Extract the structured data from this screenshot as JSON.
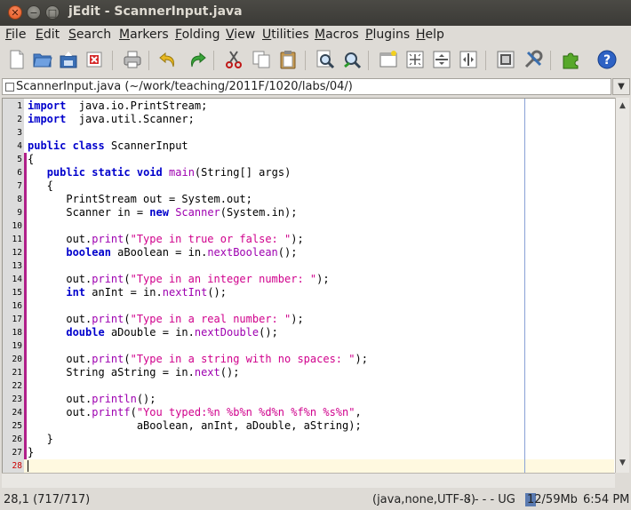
{
  "window": {
    "title": "jEdit - ScannerInput.java"
  },
  "menu": [
    {
      "mnemonic": "F",
      "rest": "ile"
    },
    {
      "mnemonic": "E",
      "rest": "dit"
    },
    {
      "mnemonic": "S",
      "rest": "earch"
    },
    {
      "mnemonic": "M",
      "rest": "arkers"
    },
    {
      "mnemonic": "F",
      "rest": "olding"
    },
    {
      "mnemonic": "V",
      "rest": "iew"
    },
    {
      "mnemonic": "U",
      "rest": "tilities"
    },
    {
      "mnemonic": "M",
      "rest": "acros"
    },
    {
      "mnemonic": "P",
      "rest": "lugins"
    },
    {
      "mnemonic": "H",
      "rest": "elp"
    }
  ],
  "toolbar": {
    "icons": [
      "new-file-icon",
      "open-file-icon",
      "reload-icon",
      "close-buffer-icon",
      "print-icon",
      "undo-icon",
      "redo-icon",
      "cut-icon",
      "copy-icon",
      "paste-icon",
      "find-icon",
      "find-next-icon",
      "new-view-icon",
      "split-horizontal-icon",
      "split-vertical-icon",
      "unsplit-icon",
      "buffer-options-icon",
      "global-options-icon",
      "plugin-manager-icon",
      "help-icon"
    ]
  },
  "buffer": {
    "label": "ScannerInput.java (~/work/teaching/2011F/1020/labs/04/)"
  },
  "editor": {
    "current_line": 28,
    "lines": [
      [
        [
          "kw",
          "import"
        ],
        [
          "",
          "  java.io.PrintStream;"
        ]
      ],
      [
        [
          "kw",
          "import"
        ],
        [
          "",
          "  java.util.Scanner;"
        ]
      ],
      [],
      [
        [
          "kw",
          "public"
        ],
        [
          "",
          " "
        ],
        [
          "kw",
          "class"
        ],
        [
          "",
          " ScannerInput"
        ]
      ],
      [
        [
          "",
          "{"
        ]
      ],
      [
        [
          "",
          "   "
        ],
        [
          "kw",
          "public"
        ],
        [
          "",
          " "
        ],
        [
          "kw",
          "static"
        ],
        [
          "",
          " "
        ],
        [
          "kw",
          "void"
        ],
        [
          "",
          " "
        ],
        [
          "fn",
          "main"
        ],
        [
          "",
          "(String[] args)"
        ]
      ],
      [
        [
          "",
          "   {"
        ]
      ],
      [
        [
          "",
          "      PrintStream out = System.out;"
        ]
      ],
      [
        [
          "",
          "      Scanner in = "
        ],
        [
          "kw",
          "new"
        ],
        [
          "",
          " "
        ],
        [
          "fn",
          "Scanner"
        ],
        [
          "",
          "(System.in);"
        ]
      ],
      [],
      [
        [
          "",
          "      out."
        ],
        [
          "fn",
          "print"
        ],
        [
          "",
          "("
        ],
        [
          "str",
          "\"Type in true or false: \""
        ],
        [
          "",
          ");"
        ]
      ],
      [
        [
          "",
          "      "
        ],
        [
          "kw",
          "boolean"
        ],
        [
          "",
          " aBoolean = in."
        ],
        [
          "fn",
          "nextBoolean"
        ],
        [
          "",
          "();"
        ]
      ],
      [],
      [
        [
          "",
          "      out."
        ],
        [
          "fn",
          "print"
        ],
        [
          "",
          "("
        ],
        [
          "str",
          "\"Type in an integer number: \""
        ],
        [
          "",
          ");"
        ]
      ],
      [
        [
          "",
          "      "
        ],
        [
          "kw",
          "int"
        ],
        [
          "",
          " anInt = in."
        ],
        [
          "fn",
          "nextInt"
        ],
        [
          "",
          "();"
        ]
      ],
      [],
      [
        [
          "",
          "      out."
        ],
        [
          "fn",
          "print"
        ],
        [
          "",
          "("
        ],
        [
          "str",
          "\"Type in a real number: \""
        ],
        [
          "",
          ");"
        ]
      ],
      [
        [
          "",
          "      "
        ],
        [
          "kw",
          "double"
        ],
        [
          "",
          " aDouble = in."
        ],
        [
          "fn",
          "nextDouble"
        ],
        [
          "",
          "();"
        ]
      ],
      [],
      [
        [
          "",
          "      out."
        ],
        [
          "fn",
          "print"
        ],
        [
          "",
          "("
        ],
        [
          "str",
          "\"Type in a string with no spaces: \""
        ],
        [
          "",
          ");"
        ]
      ],
      [
        [
          "",
          "      String aString = in."
        ],
        [
          "fn",
          "next"
        ],
        [
          "",
          "();"
        ]
      ],
      [],
      [
        [
          "",
          "      out."
        ],
        [
          "fn",
          "println"
        ],
        [
          "",
          "();"
        ]
      ],
      [
        [
          "",
          "      out."
        ],
        [
          "fn",
          "printf"
        ],
        [
          "",
          "("
        ],
        [
          "str",
          "\"You typed:%n %b%n %d%n %f%n %s%n\""
        ],
        [
          "",
          ","
        ]
      ],
      [
        [
          "",
          "                 aBoolean, anInt, aDouble, aString);"
        ]
      ],
      [
        [
          "",
          "   }"
        ]
      ],
      [
        [
          "",
          "}"
        ]
      ],
      []
    ]
  },
  "status": {
    "position": "28,1 (717/717)",
    "mode": "(java,none,UTF-8)",
    "flags": "- - - - UG",
    "memory": "12/59Mb",
    "memory_fraction": 0.2,
    "clock": "6:54 PM"
  }
}
